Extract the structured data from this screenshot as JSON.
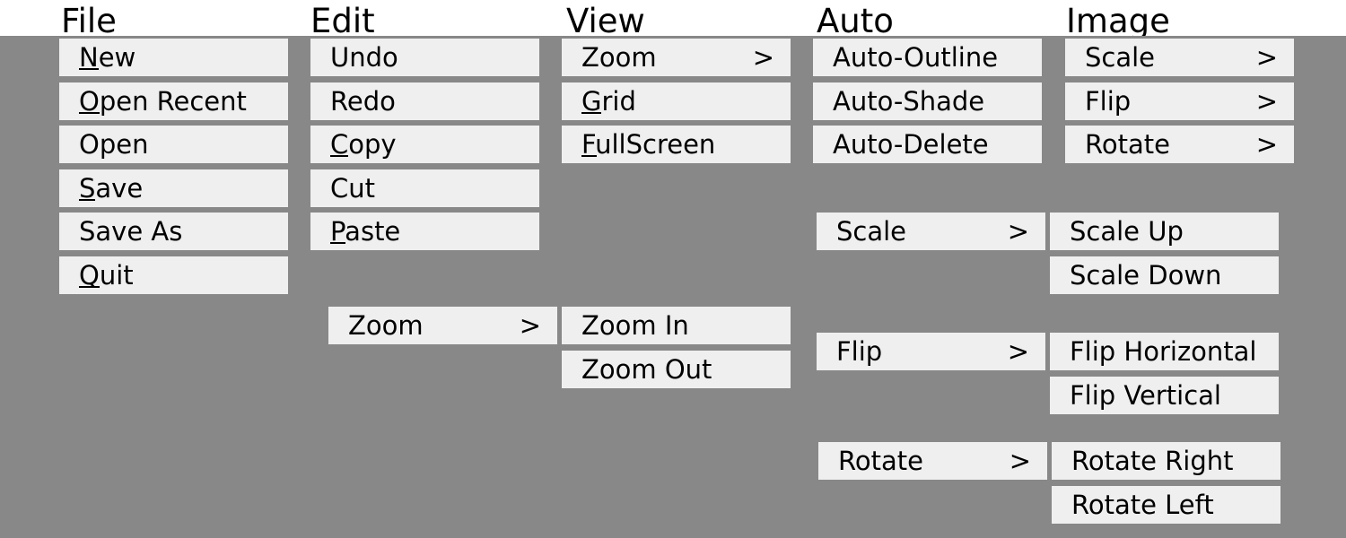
{
  "menus": [
    {
      "id": "file",
      "title": "File",
      "items": [
        {
          "label": "New",
          "acc": "N"
        },
        {
          "label": "Open Recent",
          "acc": "O"
        },
        {
          "label": "Open"
        },
        {
          "label": "Save",
          "acc": "S"
        },
        {
          "label": "Save As"
        },
        {
          "label": "Quit",
          "acc": "Q"
        }
      ]
    },
    {
      "id": "edit",
      "title": "Edit",
      "items": [
        {
          "label": "Undo"
        },
        {
          "label": "Redo"
        },
        {
          "label": "Copy",
          "acc": "C"
        },
        {
          "label": "Cut"
        },
        {
          "label": "Paste",
          "acc": "P"
        }
      ]
    },
    {
      "id": "view",
      "title": "View",
      "items": [
        {
          "label": "Zoom",
          "arrow": ">"
        },
        {
          "label": "Grid",
          "acc": "G"
        },
        {
          "label": "FullScreen",
          "acc": "F"
        }
      ]
    },
    {
      "id": "auto",
      "title": "Auto",
      "items": [
        {
          "label": "Auto-Outline"
        },
        {
          "label": "Auto-Shade"
        },
        {
          "label": "Auto-Delete"
        }
      ]
    },
    {
      "id": "image",
      "title": "Image",
      "items": [
        {
          "label": "Scale",
          "arrow": ">"
        },
        {
          "label": "Flip",
          "arrow": ">"
        },
        {
          "label": "Rotate",
          "arrow": ">"
        }
      ]
    }
  ],
  "submenus": [
    {
      "id": "zoom",
      "parent": {
        "label": "Zoom",
        "arrow": ">"
      },
      "items": [
        {
          "label": "Zoom In"
        },
        {
          "label": "Zoom Out"
        }
      ]
    },
    {
      "id": "scale",
      "parent": {
        "label": "Scale",
        "arrow": ">"
      },
      "items": [
        {
          "label": "Scale Up"
        },
        {
          "label": "Scale Down"
        }
      ]
    },
    {
      "id": "flip",
      "parent": {
        "label": "Flip",
        "arrow": ">"
      },
      "items": [
        {
          "label": "Flip Horizontal"
        },
        {
          "label": "Flip Vertical"
        }
      ]
    },
    {
      "id": "rotate",
      "parent": {
        "label": "Rotate",
        "arrow": ">"
      },
      "items": [
        {
          "label": "Rotate  Right"
        },
        {
          "label": "Rotate  Left"
        }
      ]
    }
  ]
}
